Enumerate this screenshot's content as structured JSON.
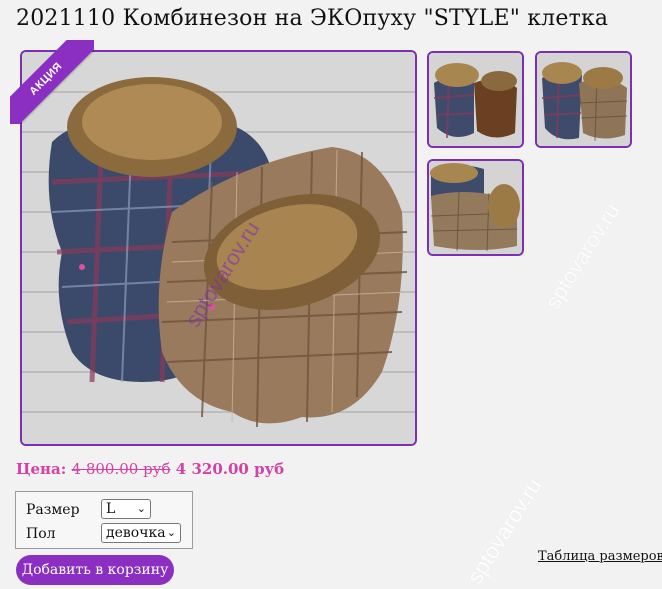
{
  "product": {
    "title": "2021110 Комбинезон на ЭКОпуху \"STYLE\" клетка"
  },
  "badge": {
    "label": "АКЦИЯ"
  },
  "watermark": {
    "text": "sptovarov.ru"
  },
  "price": {
    "label": "Цена:",
    "old": "4 800.00 руб",
    "new": "4 320.00 руб"
  },
  "options": {
    "size": {
      "label": "Размер",
      "selected": "L"
    },
    "sex": {
      "label": "Пол",
      "selected": "девочка"
    }
  },
  "actions": {
    "add_to_cart": "Добавить в корзину",
    "size_table": "Таблица размеров"
  },
  "colors": {
    "accent": "#8a2fc2",
    "price": "#d63fa6"
  }
}
